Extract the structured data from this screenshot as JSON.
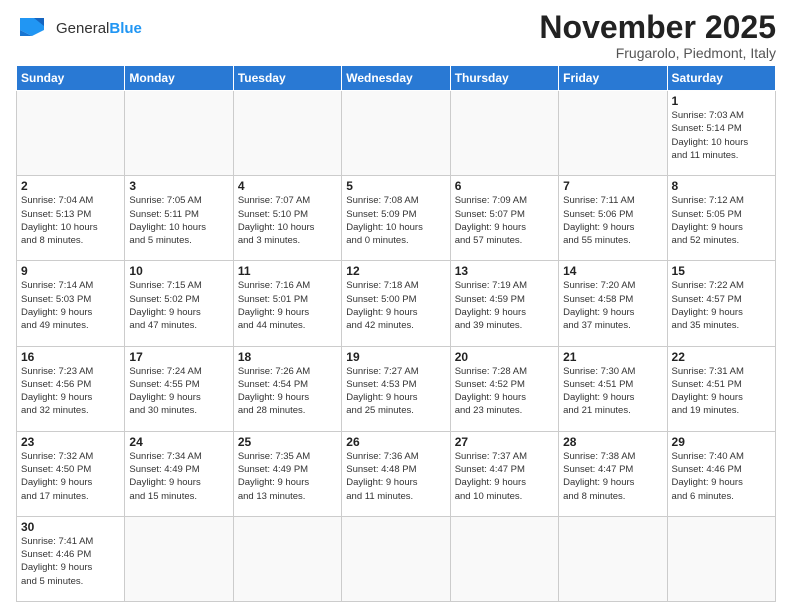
{
  "header": {
    "logo_general": "General",
    "logo_blue": "Blue",
    "title": "November 2025",
    "subtitle": "Frugarolo, Piedmont, Italy"
  },
  "columns": [
    "Sunday",
    "Monday",
    "Tuesday",
    "Wednesday",
    "Thursday",
    "Friday",
    "Saturday"
  ],
  "weeks": [
    [
      {
        "day": "",
        "info": ""
      },
      {
        "day": "",
        "info": ""
      },
      {
        "day": "",
        "info": ""
      },
      {
        "day": "",
        "info": ""
      },
      {
        "day": "",
        "info": ""
      },
      {
        "day": "",
        "info": ""
      },
      {
        "day": "1",
        "info": "Sunrise: 7:03 AM\nSunset: 5:14 PM\nDaylight: 10 hours\nand 11 minutes."
      }
    ],
    [
      {
        "day": "2",
        "info": "Sunrise: 7:04 AM\nSunset: 5:13 PM\nDaylight: 10 hours\nand 8 minutes."
      },
      {
        "day": "3",
        "info": "Sunrise: 7:05 AM\nSunset: 5:11 PM\nDaylight: 10 hours\nand 5 minutes."
      },
      {
        "day": "4",
        "info": "Sunrise: 7:07 AM\nSunset: 5:10 PM\nDaylight: 10 hours\nand 3 minutes."
      },
      {
        "day": "5",
        "info": "Sunrise: 7:08 AM\nSunset: 5:09 PM\nDaylight: 10 hours\nand 0 minutes."
      },
      {
        "day": "6",
        "info": "Sunrise: 7:09 AM\nSunset: 5:07 PM\nDaylight: 9 hours\nand 57 minutes."
      },
      {
        "day": "7",
        "info": "Sunrise: 7:11 AM\nSunset: 5:06 PM\nDaylight: 9 hours\nand 55 minutes."
      },
      {
        "day": "8",
        "info": "Sunrise: 7:12 AM\nSunset: 5:05 PM\nDaylight: 9 hours\nand 52 minutes."
      }
    ],
    [
      {
        "day": "9",
        "info": "Sunrise: 7:14 AM\nSunset: 5:03 PM\nDaylight: 9 hours\nand 49 minutes."
      },
      {
        "day": "10",
        "info": "Sunrise: 7:15 AM\nSunset: 5:02 PM\nDaylight: 9 hours\nand 47 minutes."
      },
      {
        "day": "11",
        "info": "Sunrise: 7:16 AM\nSunset: 5:01 PM\nDaylight: 9 hours\nand 44 minutes."
      },
      {
        "day": "12",
        "info": "Sunrise: 7:18 AM\nSunset: 5:00 PM\nDaylight: 9 hours\nand 42 minutes."
      },
      {
        "day": "13",
        "info": "Sunrise: 7:19 AM\nSunset: 4:59 PM\nDaylight: 9 hours\nand 39 minutes."
      },
      {
        "day": "14",
        "info": "Sunrise: 7:20 AM\nSunset: 4:58 PM\nDaylight: 9 hours\nand 37 minutes."
      },
      {
        "day": "15",
        "info": "Sunrise: 7:22 AM\nSunset: 4:57 PM\nDaylight: 9 hours\nand 35 minutes."
      }
    ],
    [
      {
        "day": "16",
        "info": "Sunrise: 7:23 AM\nSunset: 4:56 PM\nDaylight: 9 hours\nand 32 minutes."
      },
      {
        "day": "17",
        "info": "Sunrise: 7:24 AM\nSunset: 4:55 PM\nDaylight: 9 hours\nand 30 minutes."
      },
      {
        "day": "18",
        "info": "Sunrise: 7:26 AM\nSunset: 4:54 PM\nDaylight: 9 hours\nand 28 minutes."
      },
      {
        "day": "19",
        "info": "Sunrise: 7:27 AM\nSunset: 4:53 PM\nDaylight: 9 hours\nand 25 minutes."
      },
      {
        "day": "20",
        "info": "Sunrise: 7:28 AM\nSunset: 4:52 PM\nDaylight: 9 hours\nand 23 minutes."
      },
      {
        "day": "21",
        "info": "Sunrise: 7:30 AM\nSunset: 4:51 PM\nDaylight: 9 hours\nand 21 minutes."
      },
      {
        "day": "22",
        "info": "Sunrise: 7:31 AM\nSunset: 4:51 PM\nDaylight: 9 hours\nand 19 minutes."
      }
    ],
    [
      {
        "day": "23",
        "info": "Sunrise: 7:32 AM\nSunset: 4:50 PM\nDaylight: 9 hours\nand 17 minutes."
      },
      {
        "day": "24",
        "info": "Sunrise: 7:34 AM\nSunset: 4:49 PM\nDaylight: 9 hours\nand 15 minutes."
      },
      {
        "day": "25",
        "info": "Sunrise: 7:35 AM\nSunset: 4:49 PM\nDaylight: 9 hours\nand 13 minutes."
      },
      {
        "day": "26",
        "info": "Sunrise: 7:36 AM\nSunset: 4:48 PM\nDaylight: 9 hours\nand 11 minutes."
      },
      {
        "day": "27",
        "info": "Sunrise: 7:37 AM\nSunset: 4:47 PM\nDaylight: 9 hours\nand 10 minutes."
      },
      {
        "day": "28",
        "info": "Sunrise: 7:38 AM\nSunset: 4:47 PM\nDaylight: 9 hours\nand 8 minutes."
      },
      {
        "day": "29",
        "info": "Sunrise: 7:40 AM\nSunset: 4:46 PM\nDaylight: 9 hours\nand 6 minutes."
      }
    ],
    [
      {
        "day": "30",
        "info": "Sunrise: 7:41 AM\nSunset: 4:46 PM\nDaylight: 9 hours\nand 5 minutes."
      },
      {
        "day": "",
        "info": ""
      },
      {
        "day": "",
        "info": ""
      },
      {
        "day": "",
        "info": ""
      },
      {
        "day": "",
        "info": ""
      },
      {
        "day": "",
        "info": ""
      },
      {
        "day": "",
        "info": ""
      }
    ]
  ]
}
